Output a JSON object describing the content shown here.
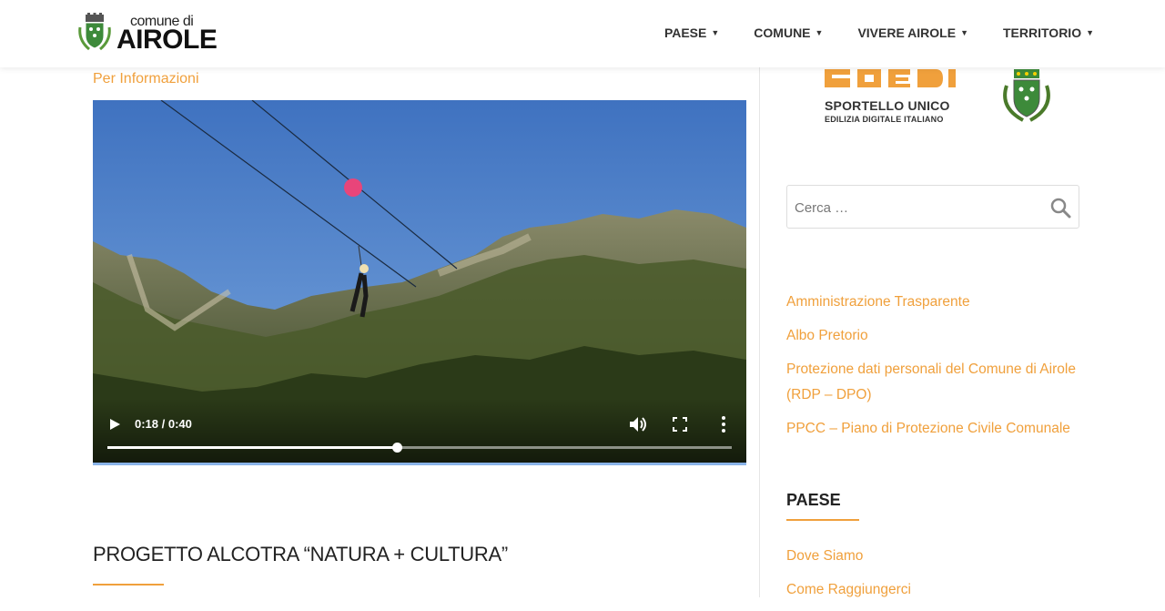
{
  "header": {
    "logo_small": "comune di",
    "logo_big": "AIROLE",
    "nav": [
      {
        "label": "PAESE"
      },
      {
        "label": "COMUNE"
      },
      {
        "label": "VIVERE AIROLE"
      },
      {
        "label": "TERRITORIO"
      }
    ]
  },
  "main": {
    "info_link": "Per Informazioni",
    "video": {
      "time": "0:18 / 0:40",
      "progress": 0.463
    },
    "post_title": "PROGETTO ALCOTRA “NATURA + CULTURA”"
  },
  "sidebar": {
    "sue_title": "SPORTELLO UNICO",
    "sue_subtitle": "EDILIZIA DIGITALE ITALIANO",
    "search": {
      "placeholder": "Cerca …"
    },
    "links": [
      {
        "label": "Amministrazione Trasparente"
      },
      {
        "label": "Albo Pretorio"
      },
      {
        "label": "Protezione dati personali del Comune di Airole (RDP – DPO)"
      },
      {
        "label": "PPCC – Piano di Protezione Civile Comunale"
      }
    ],
    "widget_title": "PAESE",
    "widget_links": [
      {
        "label": "Dove Siamo"
      },
      {
        "label": "Come Raggiungerci"
      }
    ]
  },
  "colors": {
    "accent": "#f0a03c",
    "crest_green": "#3d8a3a"
  }
}
